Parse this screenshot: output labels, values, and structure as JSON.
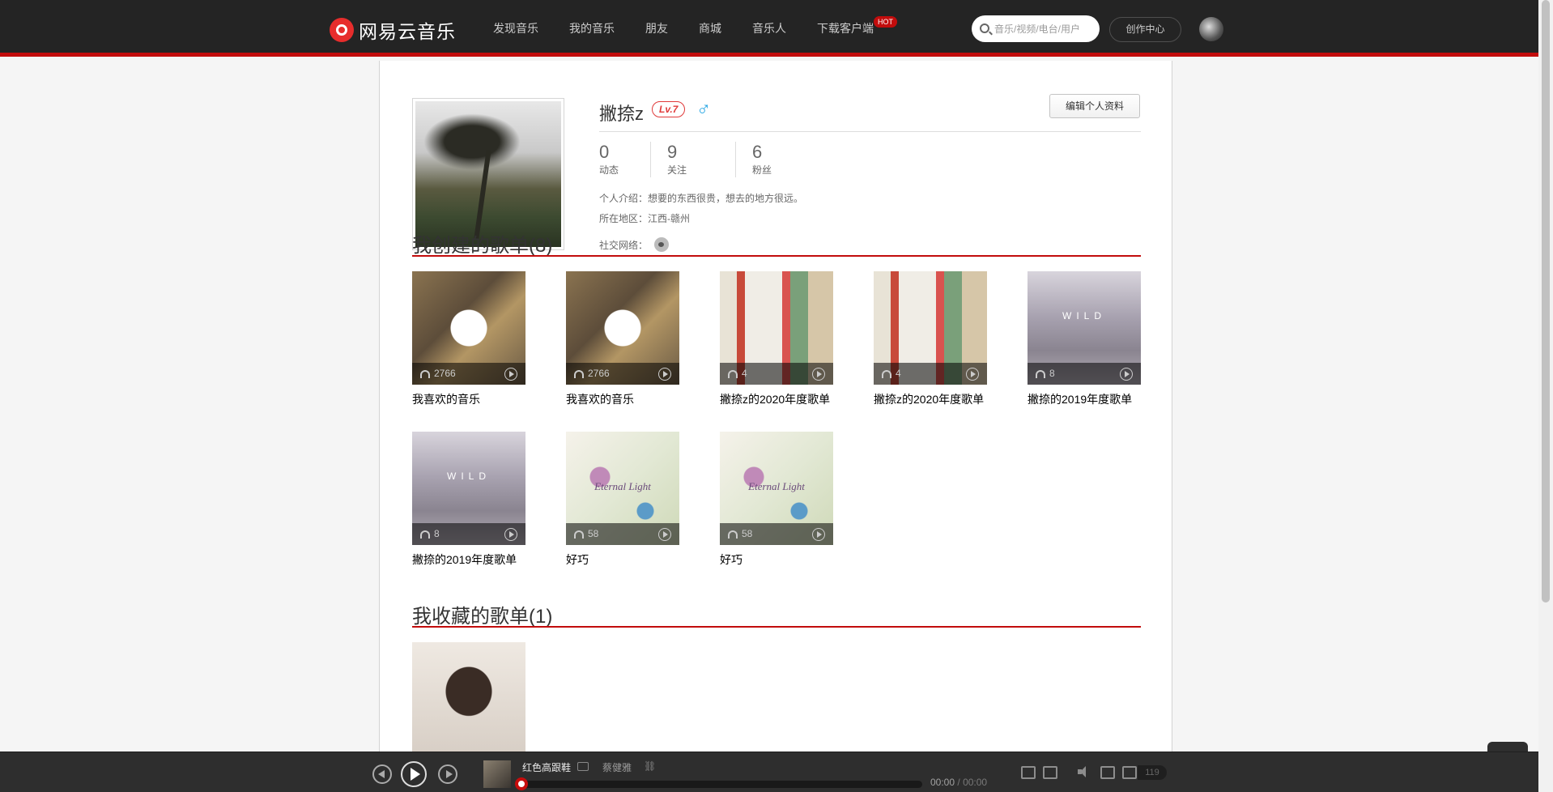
{
  "header": {
    "logo_text": "网易云音乐",
    "nav": [
      {
        "label": "发现音乐"
      },
      {
        "label": "我的音乐"
      },
      {
        "label": "朋友"
      },
      {
        "label": "商城"
      },
      {
        "label": "音乐人"
      },
      {
        "label": "下载客户端",
        "badge": "HOT"
      }
    ],
    "search_placeholder": "音乐/视频/电台/用户",
    "creator_center": "创作中心"
  },
  "profile": {
    "name": "撇捺z",
    "level": "Lv.7",
    "gender_icon": "male-icon",
    "edit_button": "编辑个人资料",
    "stats": [
      {
        "value": "0",
        "label": "动态"
      },
      {
        "value": "9",
        "label": "关注"
      },
      {
        "value": "6",
        "label": "粉丝"
      }
    ],
    "bio_label": "个人介绍：",
    "bio": "想要的东西很贵，想去的地方很远。",
    "region_label": "所在地区：",
    "region": "江西-赣州",
    "social_label": "社交网络：",
    "social_icon": "weibo-icon"
  },
  "created": {
    "title": "我创建的歌单(8)",
    "playlists": [
      {
        "name": "我喜欢的音乐",
        "plays": "2766",
        "cover": "fav"
      },
      {
        "name": "我喜欢的音乐",
        "plays": "2766",
        "cover": "fav"
      },
      {
        "name": "撇捺z的2020年度歌单",
        "plays": "4",
        "cover": "anime"
      },
      {
        "name": "撇捺z的2020年度歌单",
        "plays": "4",
        "cover": "anime"
      },
      {
        "name": "撇捺的2019年度歌单",
        "plays": "8",
        "cover": "wild"
      },
      {
        "name": "撇捺的2019年度歌单",
        "plays": "8",
        "cover": "wild"
      },
      {
        "name": "好巧",
        "plays": "58",
        "cover": "light"
      },
      {
        "name": "好巧",
        "plays": "58",
        "cover": "light"
      }
    ],
    "cover_text_wild": "WILD",
    "cover_text_light": "Eternal Light"
  },
  "collected": {
    "title": "我收藏的歌单(1)"
  },
  "player": {
    "song": "红色高跟鞋",
    "artist": "蔡健雅",
    "time_current": "00:00",
    "time_sep": "/",
    "time_total": "00:00",
    "progress": 0.0,
    "playlist_count": "119"
  },
  "colors": {
    "accent": "#c20c0c",
    "topbar": "#242424",
    "player_bg": "#2e2e2e"
  }
}
